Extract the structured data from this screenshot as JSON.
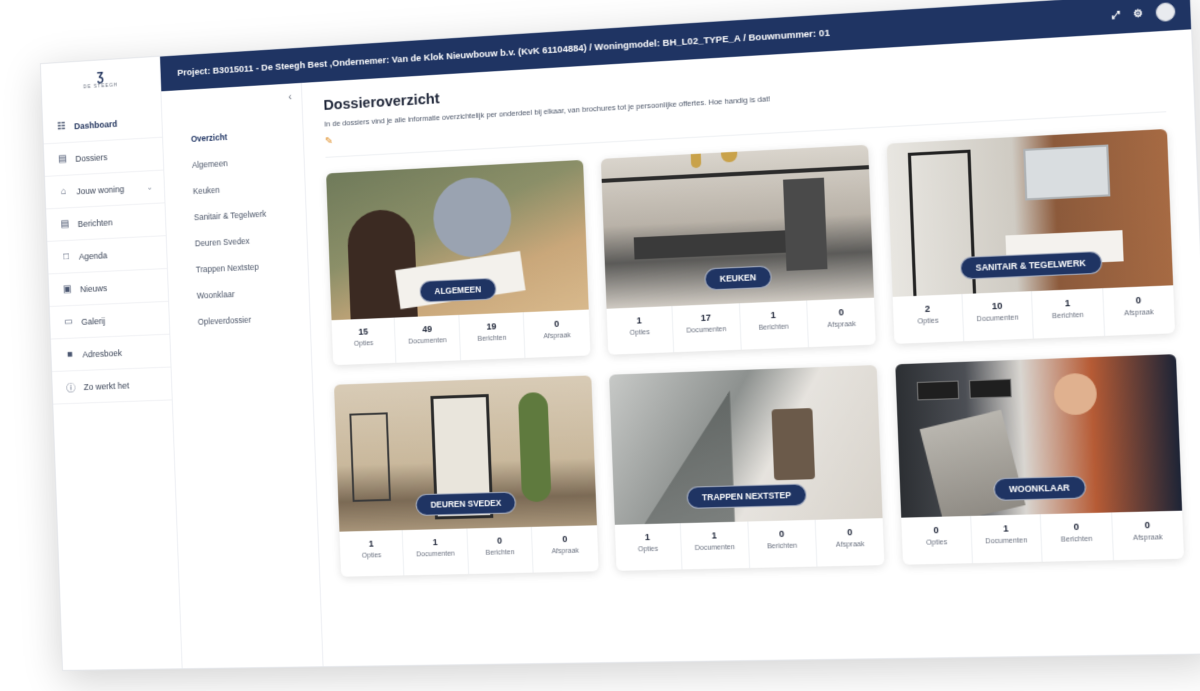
{
  "brand": {
    "mark": "Ʒ",
    "name": "DE STEEGH"
  },
  "sidebar": {
    "items": [
      {
        "label": "Dashboard",
        "icon": "grid-icon",
        "glyph": "☷"
      },
      {
        "label": "Dossiers",
        "icon": "folder-icon",
        "glyph": "▤"
      },
      {
        "label": "Jouw woning",
        "icon": "home-icon",
        "glyph": "⌂",
        "chevron": "⌄"
      },
      {
        "label": "Berichten",
        "icon": "message-icon",
        "glyph": "▤"
      },
      {
        "label": "Agenda",
        "icon": "calendar-icon",
        "glyph": "□"
      },
      {
        "label": "Nieuws",
        "icon": "news-icon",
        "glyph": "▣"
      },
      {
        "label": "Galerij",
        "icon": "gallery-icon",
        "glyph": "▭"
      },
      {
        "label": "Adresboek",
        "icon": "address-book-icon",
        "glyph": "■"
      },
      {
        "label": "Zo werkt het",
        "icon": "help-icon",
        "glyph": "ⓘ"
      }
    ]
  },
  "topbar": {
    "project": "Project: B3015011 - De Steegh Best ,Ondernemer: Van de Klok Nieuwbouw b.v. (KvK 61104884) / Woningmodel: BH_L02_TYPE_A / Bouwnummer: 01",
    "expand_glyph": "⤢",
    "settings_glyph": "⚙"
  },
  "subnav": {
    "collapse_glyph": "‹",
    "items": [
      "Overzicht",
      "Algemeen",
      "Keuken",
      "Sanitair & Tegelwerk",
      "Deuren Svedex",
      "Trappen Nextstep",
      "Woonklaar",
      "Opleverdossier"
    ]
  },
  "page": {
    "title": "Dossieroverzicht",
    "intro": "In de dossiers vind je alle informatie overzichtelijk per onderdeel bij elkaar, van brochures tot je persoonlijke offertes. Hoe handig is dat!",
    "edit_glyph": "✎"
  },
  "stat_labels": [
    "Opties",
    "Documenten",
    "Berichten",
    "Afspraak"
  ],
  "cards": [
    {
      "title": "ALGEMEEN",
      "stats": [
        "15",
        "49",
        "19",
        "0"
      ]
    },
    {
      "title": "KEUKEN",
      "stats": [
        "1",
        "17",
        "1",
        "0"
      ]
    },
    {
      "title": "SANITAIR & TEGELWERK",
      "stats": [
        "2",
        "10",
        "1",
        "0"
      ]
    },
    {
      "title": "DEUREN SVEDEX",
      "stats": [
        "1",
        "1",
        "0",
        "0"
      ]
    },
    {
      "title": "TRAPPEN NEXTSTEP",
      "stats": [
        "1",
        "1",
        "0",
        "0"
      ]
    },
    {
      "title": "WOONKLAAR",
      "stats": [
        "0",
        "1",
        "0",
        "0"
      ]
    }
  ],
  "colors": {
    "navy": "#1f3463",
    "accent": "#e0902b"
  }
}
